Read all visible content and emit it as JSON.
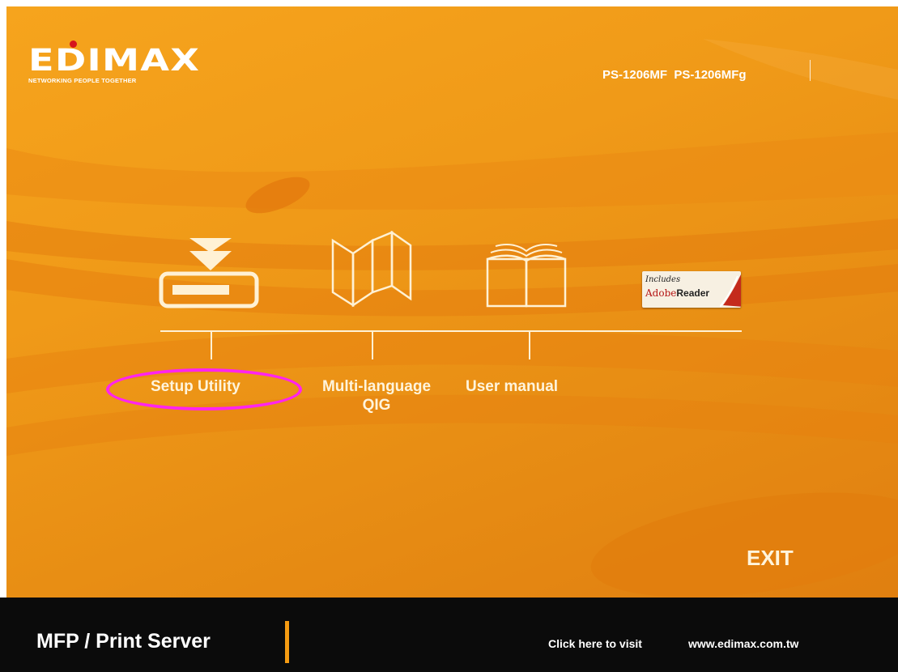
{
  "brand": {
    "logo_text": "EDIMAX",
    "tagline": "NETWORKING PEOPLE TOGETHER",
    "accent_dot_color": "#d6141c"
  },
  "header": {
    "models": "PS-1206MF  PS-1206MFg"
  },
  "menu": {
    "items": [
      {
        "label": "Setup Utility",
        "icon": "install-download-icon"
      },
      {
        "label_line1": "Multi-language",
        "label_line2": "QIG",
        "icon": "folded-map-icon"
      },
      {
        "label": "User manual",
        "icon": "open-book-icon"
      }
    ],
    "adobe_badge": {
      "line1": "Includes",
      "line2_a": "Adobe",
      "line2_b": "Reader"
    }
  },
  "exit_label": "EXIT",
  "footer": {
    "title": "MFP / Print Server",
    "visit_text": "Click here to visit",
    "url": "www.edimax.com.tw"
  },
  "annotation": {
    "highlight_color": "#ff24ee",
    "highlight_target": "Setup Utility"
  },
  "colors": {
    "background": "#f09a18",
    "footer": "#0b0b0b",
    "label": "#fff4dc"
  }
}
